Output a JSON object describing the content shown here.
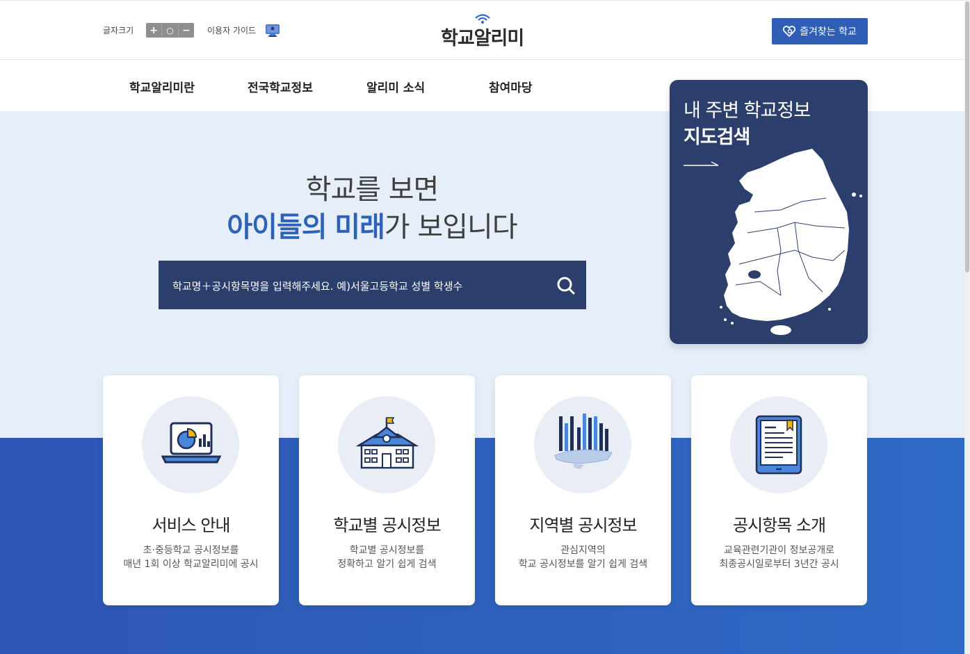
{
  "header": {
    "font_size_label": "글자크기",
    "font_size_increase": "+",
    "font_size_reset": "○",
    "font_size_decrease": "−",
    "guide_label": "이용자 가이드",
    "logo_text": "학교알리미",
    "favorites_label": "즐겨찾는 학교"
  },
  "nav": {
    "items": [
      "학교알리미란",
      "전국학교정보",
      "알리미 소식",
      "참여마당"
    ]
  },
  "hero": {
    "line1": "학교를 보면",
    "line2_highlight1": "아이들의",
    "line2_highlight2": "미래",
    "line2_rest": "가 보입니다",
    "search_placeholder": "학교명＋공시항목명을 입력해주세요. 예)서울고등학교 성별 학생수"
  },
  "map_card": {
    "title_line1": "내 주변 학교정보",
    "title_line2": "지도검색"
  },
  "cards": [
    {
      "title": "서비스 안내",
      "desc1": "초·중등학교 공시정보를",
      "desc2": "매년 1회 이상 학교알리미에 공시",
      "icon": "laptop-chart-icon"
    },
    {
      "title": "학교별 공시정보",
      "desc1": "학교별 공시정보를",
      "desc2": "정확하고 알기 쉽게 검색",
      "icon": "school-building-icon"
    },
    {
      "title": "지역별 공시정보",
      "desc1": "관심지역의",
      "desc2": "학교 공시정보를 알기 쉽게 검색",
      "icon": "region-bar-chart-icon"
    },
    {
      "title": "공시항목 소개",
      "desc1": "교육관련기관이 정보공개로",
      "desc2": "최종공시일로부터 3년간 공시",
      "icon": "document-tablet-icon"
    }
  ],
  "colors": {
    "primary": "#2f5fb4",
    "navy": "#2c3e6b",
    "hero_bg": "#e5eef9",
    "accent_yellow": "#f5b400"
  }
}
